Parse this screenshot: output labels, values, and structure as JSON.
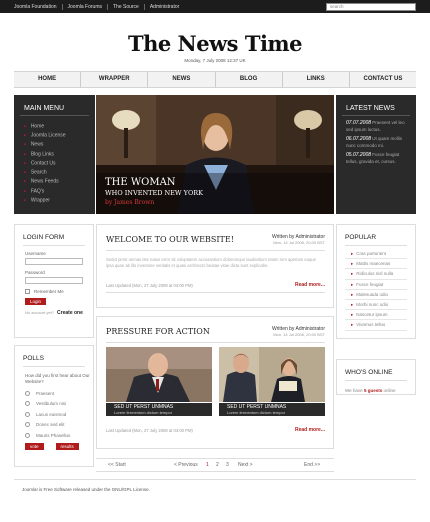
{
  "topbar": {
    "links": [
      "Joomla Foundation",
      "Joomla Forums",
      "The Source",
      "Administrator"
    ],
    "search_placeholder": "search"
  },
  "header": {
    "logo": "The News Time",
    "date": "Monday, 7 July 2008 12:37 UK"
  },
  "nav": [
    "HOME",
    "WRAPPER",
    "NEWS",
    "BLOG",
    "LINKS",
    "CONTACT US"
  ],
  "main_menu": {
    "title": "MAIN MENU",
    "items": [
      "Home",
      "Joomla License",
      "News",
      "Blog Links",
      "Contact Us",
      "Search",
      "News Feeds",
      "FAQ's",
      "Wrapper"
    ]
  },
  "hero": {
    "line1": "THE WOMAN",
    "line2": "WHO INVENTED NEW YORK",
    "author": "by James Brown"
  },
  "latest_news": {
    "title": "LATEST NEWS",
    "items": [
      {
        "date": "07.07.2008",
        "text": "Praesent vel leo sed ipsum luctus."
      },
      {
        "date": "06.07.2008",
        "text": "Ut quam mollis nunc commodo mi."
      },
      {
        "date": "05.07.2008",
        "text": "Fusce feugiat tellus, gravida et, cursus."
      }
    ]
  },
  "login": {
    "title": "LOGIN FORM",
    "username_label": "Username",
    "password_label": "Password",
    "remember_label": "Remember Me",
    "login_button": "Login",
    "forgot_text": "No account yet?",
    "create_link": "Create one"
  },
  "polls": {
    "title": "POLLS",
    "question": "How did you first hear about Our Website?",
    "options": [
      "Praesent",
      "Vestibulum nisi",
      "Lacus euismod",
      "Donec sed elit",
      "Mauris Phasellus"
    ],
    "vote_button": "vote",
    "results_button": "results"
  },
  "welcome": {
    "title": "WELCOME TO OUR WEBSITE!",
    "author": "Written by Administrator",
    "meta": "Mon, 14 Jul 2008, 20:00 BST",
    "body": "Sedut perst unmas iste natus error sit voluptatem accusantium doloremque laudantium totam rem aperiam eaque ipsa quae ab illo inventore veritatis et quasi architecto beatae vitae dicta sunt explicabo.",
    "updated": "Last Updated (Mon, 27 July 2008 at 04:00 PM)",
    "more": "Read more..."
  },
  "pressure": {
    "title": "PRESSURE FOR ACTION",
    "author": "Written by Administrator",
    "meta": "Mon, 14 Jul 2008, 20:00 BST",
    "captions": [
      {
        "title": "SED UT PERST UNMNAS",
        "sub": "Lorem fermentum dictum tempor"
      },
      {
        "title": "SED UT PERST UNMNAS",
        "sub": "Lorem fermentum dictum tempor"
      }
    ],
    "updated": "Last Updated (Mon, 27 July 2008 at 04:00 PM)",
    "more": "Read more..."
  },
  "pagination": {
    "start": "<< Start",
    "prev": "< Previous",
    "pages": [
      "1",
      "2",
      "3"
    ],
    "next": "Next >",
    "end": "End >>"
  },
  "popular": {
    "title": "POPULAR",
    "items": [
      "Cras parturient",
      "Mattis maecenas",
      "Ridiculus nisl nulla",
      "Fusce feugiat",
      "Malesuada odio",
      "Morbi nunc odio",
      "Nascetur ipsum",
      "Vivamus tellus"
    ]
  },
  "online": {
    "title": "WHO'S ONLINE",
    "prefix": "We have",
    "count": "5 guests",
    "suffix": "online"
  },
  "footer": {
    "text": "Joomla! is Free Software released under the GNU/GPL License."
  }
}
